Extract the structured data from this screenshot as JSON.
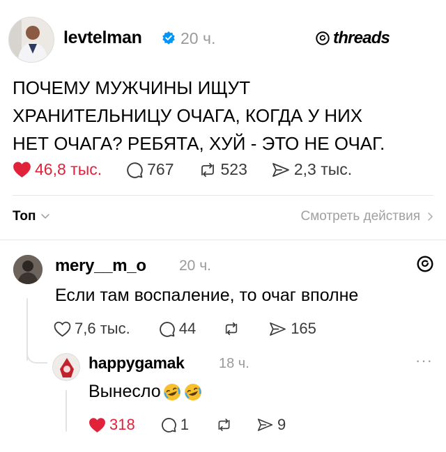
{
  "post": {
    "username": "levtelman",
    "time": "20 ч.",
    "brand": "threads",
    "text": "ПОЧЕМУ МУЖЧИНЫ ИЩУТ\nХРАНИТЕЛЬНИЦУ ОЧАГА, КОГДА У НИХ\nНЕТ ОЧАГА? РЕБЯТА, ХУЙ - ЭТО НЕ ОЧАГ.",
    "likes": "46,8 тыс.",
    "comments": "767",
    "reposts": "523",
    "shares": "2,3 тыс."
  },
  "sort": {
    "label": "Топ",
    "activity": "Смотреть действия"
  },
  "replies": [
    {
      "username": "mery__m_o",
      "time": "20 ч.",
      "text": "Если там воспаление, то очаг вполне",
      "likes": "7,6 тыс.",
      "comments": "44",
      "shares": "165"
    },
    {
      "username": "happygamak",
      "time": "18 ч.",
      "text": "Вынесло",
      "more": "···",
      "likes": "318",
      "comments": "1",
      "shares": "9"
    }
  ],
  "colors": {
    "like_active": "#e0233b",
    "verified": "#0095f6",
    "muted": "#9a9a9a"
  },
  "icons": [
    "verified-badge-icon",
    "threads-logo-icon",
    "heart-icon",
    "comment-icon",
    "repost-icon",
    "share-icon",
    "chevron-down-icon",
    "chevron-right-icon",
    "laughing-emoji-icon"
  ]
}
